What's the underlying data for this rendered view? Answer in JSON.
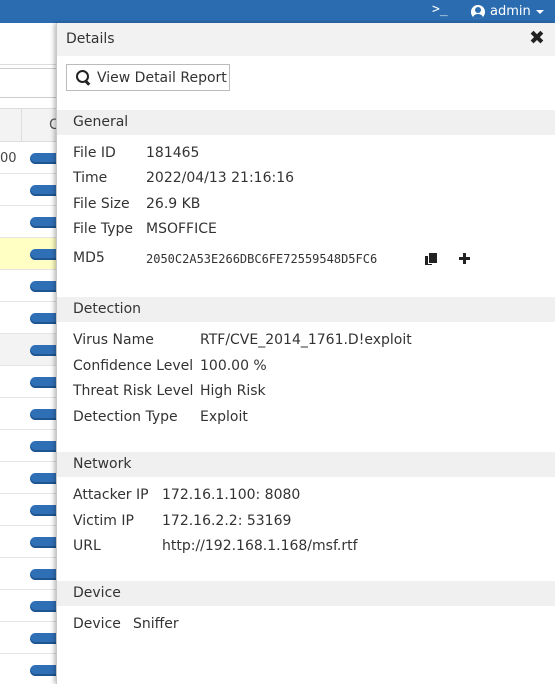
{
  "topbar": {
    "terminal_glyph": ">_",
    "user_label": "admin"
  },
  "background": {
    "column_letter": "C",
    "first_row_cut": "00"
  },
  "details": {
    "title": "Details",
    "close_glyph": "✖",
    "report_button": "View Detail Report",
    "general": {
      "heading": "General",
      "file_id_label": "File ID",
      "file_id": "181465",
      "time_label": "Time",
      "time": "2022/04/13 21:16:16",
      "file_size_label": "File Size",
      "file_size": "26.9 KB",
      "file_type_label": "File Type",
      "file_type": "MSOFFICE",
      "md5_label": "MD5",
      "md5": "2050C2A53E266DBC6FE72559548D5FC6"
    },
    "detection": {
      "heading": "Detection",
      "virus_name_label": "Virus Name",
      "virus_name": "RTF/CVE_2014_1761.D!exploit",
      "confidence_label": "Confidence Level",
      "confidence": "100.00 %",
      "threat_label": "Threat Risk Level",
      "threat": "High Risk",
      "detection_type_label": "Detection Type",
      "detection_type": "Exploit"
    },
    "network": {
      "heading": "Network",
      "attacker_label": "Attacker IP",
      "attacker": "172.16.1.100: 8080",
      "victim_label": "Victim IP",
      "victim": "172.16.2.2: 53169",
      "url_label": "URL",
      "url": "http://192.168.1.168/msf.rtf"
    },
    "device": {
      "heading": "Device",
      "device_label": "Device",
      "device": "Sniffer"
    }
  }
}
